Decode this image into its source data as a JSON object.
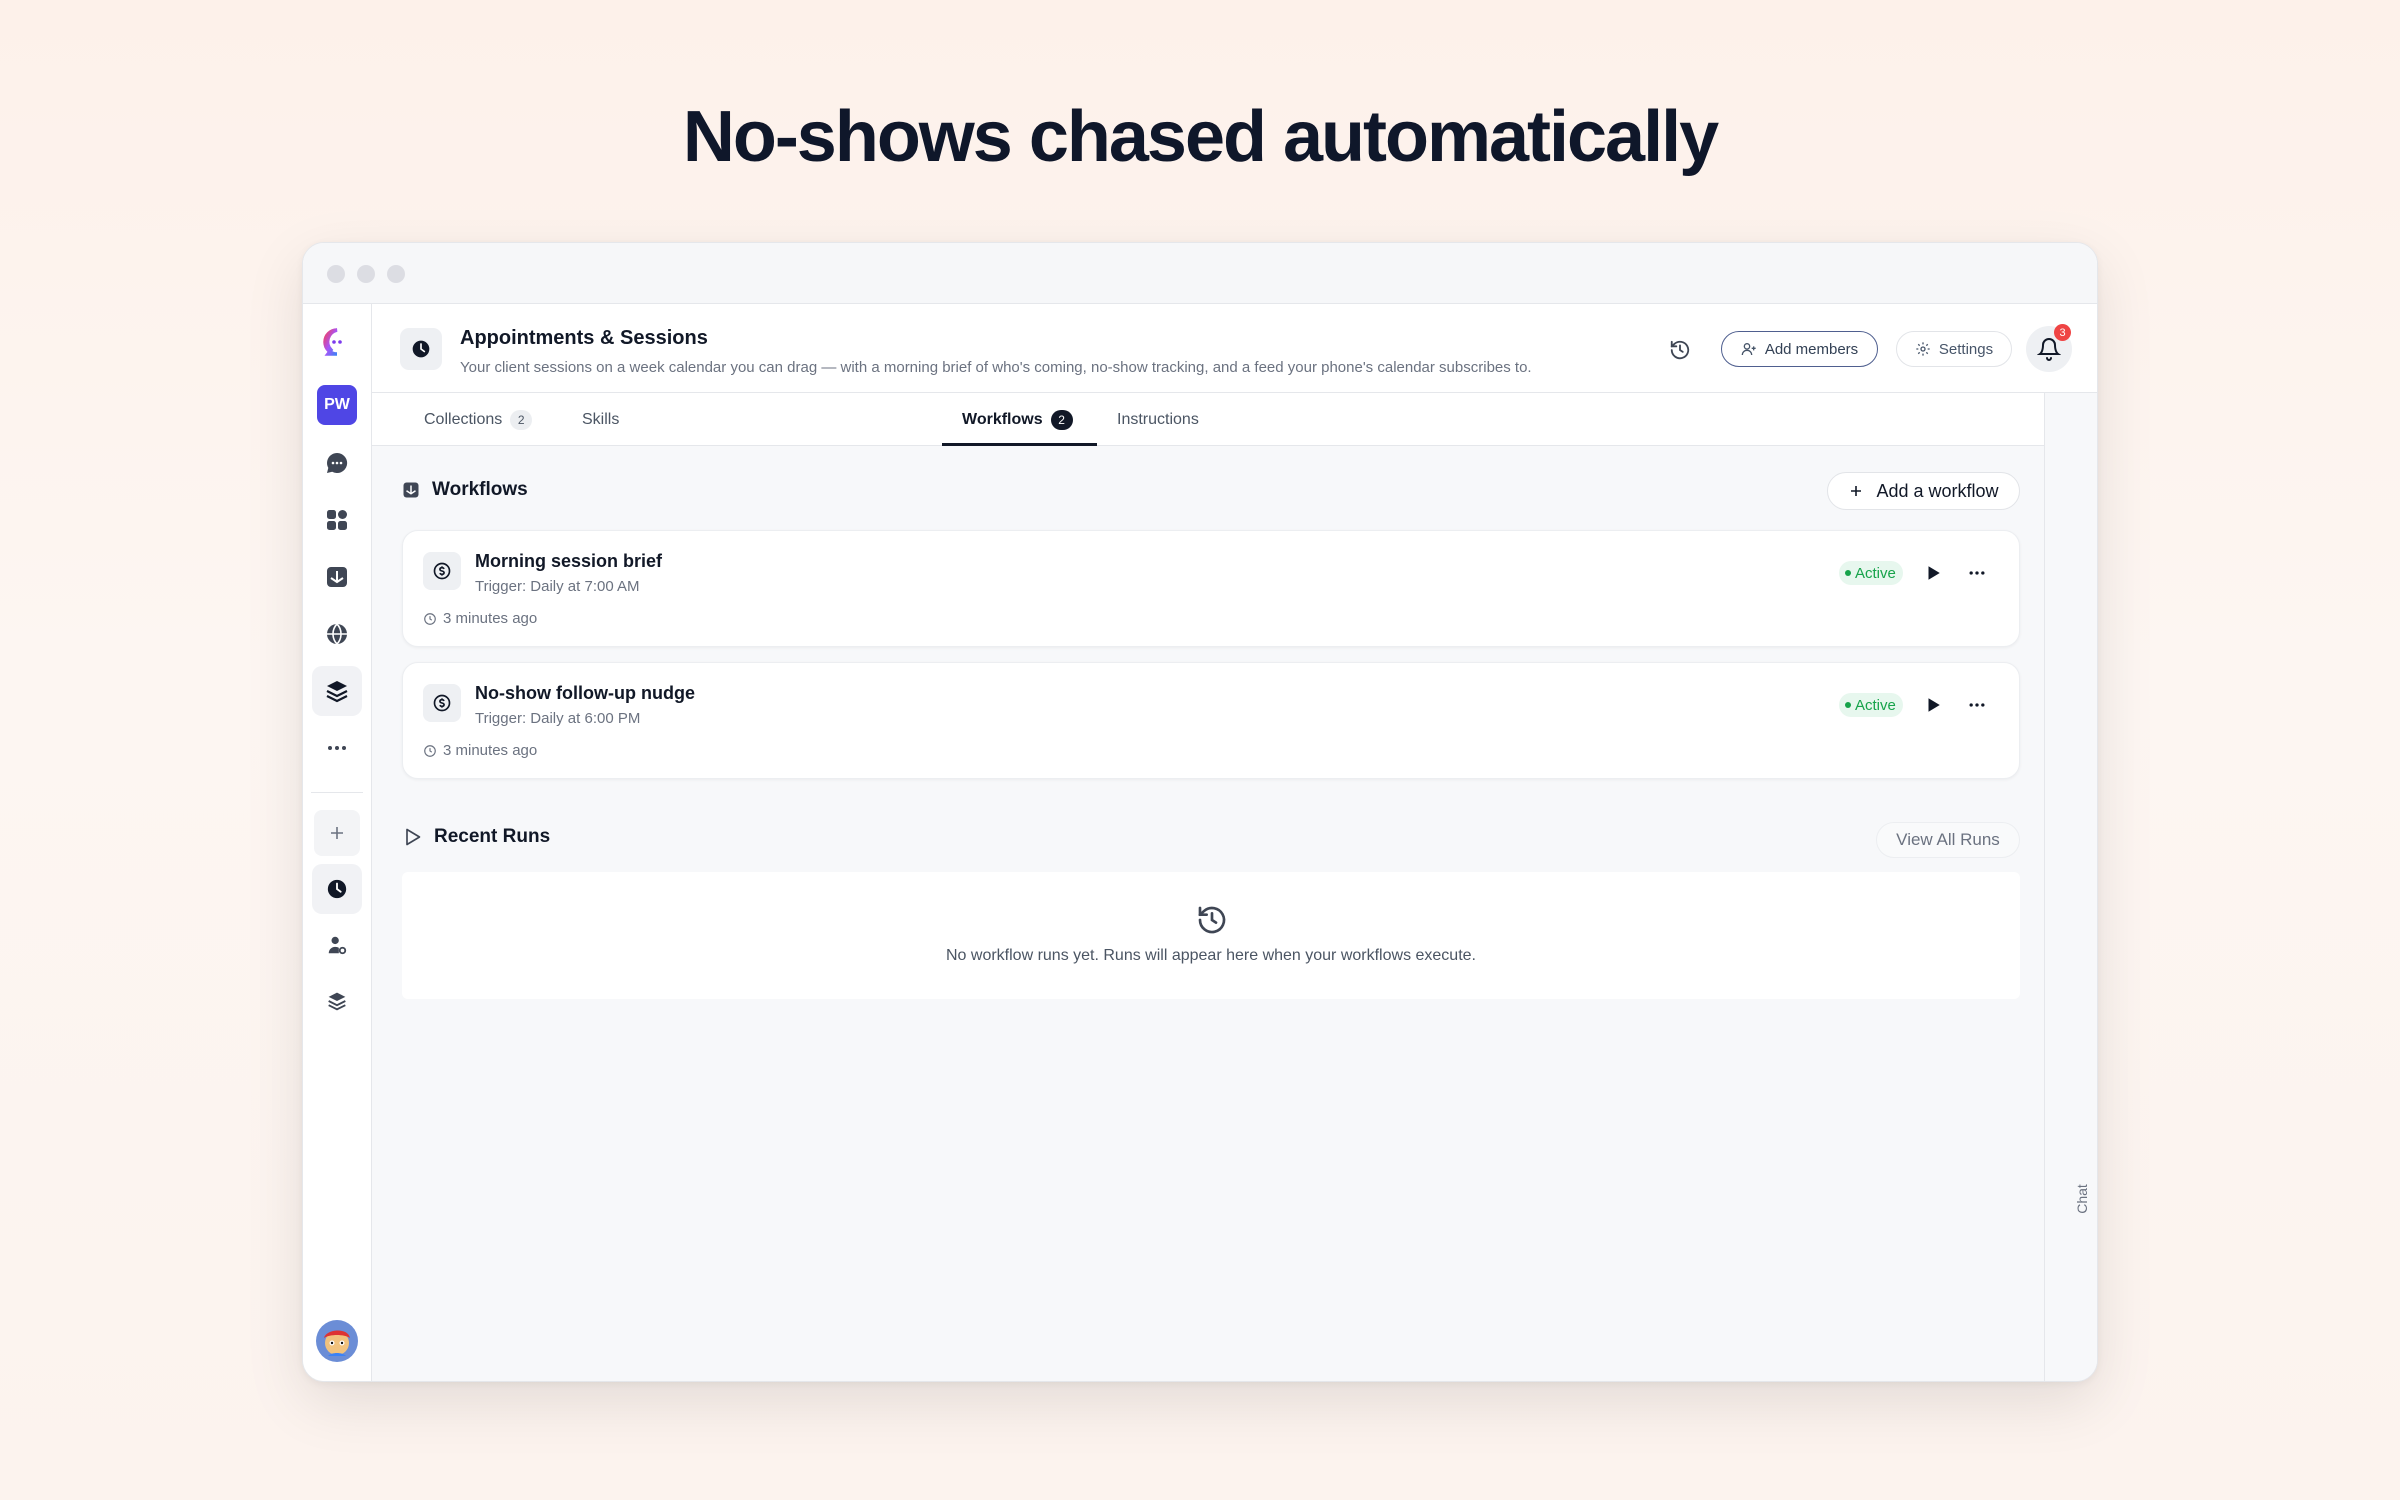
{
  "headline": "No-shows chased automatically",
  "sidebar": {
    "workspace_initials": "PW",
    "items": [
      {
        "icon": "app-logo-icon"
      },
      {
        "icon": "chat-bubble-icon"
      },
      {
        "icon": "grid-icon"
      },
      {
        "icon": "inbox-icon"
      },
      {
        "icon": "globe-icon"
      },
      {
        "icon": "layers-icon",
        "active": true
      },
      {
        "icon": "more-horizontal-icon"
      },
      {
        "icon": "plus-icon"
      },
      {
        "icon": "clock-icon",
        "active": true
      },
      {
        "icon": "user-gear-icon"
      },
      {
        "icon": "stack-icon"
      },
      {
        "icon": "user-avatar"
      }
    ]
  },
  "header": {
    "title": "Appointments & Sessions",
    "description": "Your client sessions on a week calendar you can drag — with a morning brief of who's coming, no-show tracking, and a feed your phone's calendar subscribes to.",
    "add_members_label": "Add members",
    "settings_label": "Settings",
    "notification_count": "3"
  },
  "tabs": [
    {
      "label": "Collections",
      "count": "2"
    },
    {
      "label": "Skills"
    },
    {
      "label": "Workflows",
      "count": "2",
      "active": true
    },
    {
      "label": "Instructions"
    }
  ],
  "workflows_section": {
    "title": "Workflows",
    "add_label": "Add a workflow",
    "items": [
      {
        "title": "Morning session brief",
        "trigger": "Trigger: Daily at 7:00 AM",
        "updated": "3 minutes ago",
        "status": "Active"
      },
      {
        "title": "No-show follow-up nudge",
        "trigger": "Trigger: Daily at 6:00 PM",
        "updated": "3 minutes ago",
        "status": "Active"
      }
    ]
  },
  "runs_section": {
    "title": "Recent Runs",
    "view_all_label": "View All Runs",
    "empty_text": "No workflow runs yet. Runs will appear here when your workflows execute."
  },
  "chat_rail_label": "Chat",
  "colors": {
    "accent": "#4f46e5",
    "active_green": "#16a34a",
    "badge_red": "#ef4444"
  }
}
